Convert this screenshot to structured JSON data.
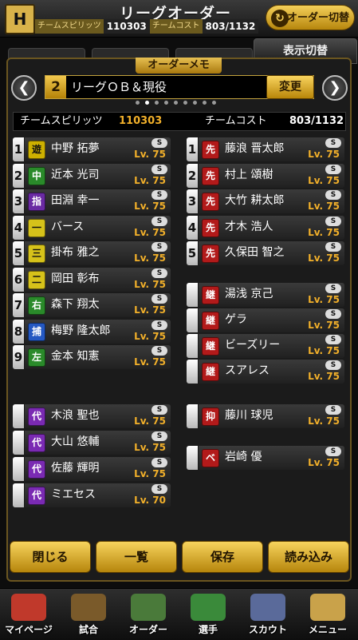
{
  "header": {
    "logo": "H",
    "title": "リーグオーダー",
    "team_spirit_label": "チームスピリッツ",
    "team_spirit_value": "110303",
    "team_cost_label": "チームコスト",
    "team_cost_value": "803/1132",
    "order_switch_label": "オーダー切替",
    "display_switch_label": "表示切替"
  },
  "memo": {
    "title": "オーダーメモ",
    "number": "2",
    "name": "リーグＯＢ＆現役",
    "change_label": "変更",
    "page_count": 9,
    "active_page": 1
  },
  "stats": {
    "spirit_label": "チームスピリッツ",
    "spirit_value": "110303",
    "cost_label": "チームコスト",
    "cost_value": "803/1132"
  },
  "lineup": [
    {
      "num": "1",
      "pos": "遊",
      "name": "中野 拓夢",
      "lv": "Lv. 75"
    },
    {
      "num": "2",
      "pos": "中",
      "name": "近本 光司",
      "lv": "Lv. 75"
    },
    {
      "num": "3",
      "pos": "指",
      "name": "田淵 幸一",
      "lv": "Lv. 75"
    },
    {
      "num": "4",
      "pos": "一",
      "name": "バース",
      "lv": "Lv. 75"
    },
    {
      "num": "5",
      "pos": "三",
      "name": "掛布 雅之",
      "lv": "Lv. 75"
    },
    {
      "num": "6",
      "pos": "二",
      "name": "岡田 彰布",
      "lv": "Lv. 75"
    },
    {
      "num": "7",
      "pos": "右",
      "name": "森下 翔太",
      "lv": "Lv. 75"
    },
    {
      "num": "8",
      "pos": "捕",
      "name": "梅野 隆太郎",
      "lv": "Lv. 75"
    },
    {
      "num": "9",
      "pos": "左",
      "name": "金本 知憲",
      "lv": "Lv. 75"
    }
  ],
  "bench": [
    {
      "pos": "代",
      "name": "木浪 聖也",
      "lv": "Lv. 75"
    },
    {
      "pos": "代",
      "name": "大山 悠輔",
      "lv": "Lv. 75"
    },
    {
      "pos": "代",
      "name": "佐藤 輝明",
      "lv": "Lv. 75"
    },
    {
      "pos": "代",
      "name": "ミエセス",
      "lv": "Lv. 70"
    }
  ],
  "starters": [
    {
      "num": "1",
      "pos": "先",
      "name": "藤浪 晋太郎",
      "lv": "Lv. 75"
    },
    {
      "num": "2",
      "pos": "先",
      "name": "村上 頌樹",
      "lv": "Lv. 75"
    },
    {
      "num": "3",
      "pos": "先",
      "name": "大竹 耕太郎",
      "lv": "Lv. 75"
    },
    {
      "num": "4",
      "pos": "先",
      "name": "才木 浩人",
      "lv": "Lv. 75"
    },
    {
      "num": "5",
      "pos": "先",
      "name": "久保田 智之",
      "lv": "Lv. 75"
    }
  ],
  "relievers": [
    {
      "pos": "継",
      "name": "湯浅 京己",
      "lv": "Lv. 75"
    },
    {
      "pos": "継",
      "name": "ゲラ",
      "lv": "Lv. 75"
    },
    {
      "pos": "継",
      "name": "ビーズリー",
      "lv": "Lv. 75"
    },
    {
      "pos": "継",
      "name": "スアレス",
      "lv": "Lv. 75"
    }
  ],
  "closer": {
    "pos": "抑",
    "name": "藤川 球児",
    "lv": "Lv. 75"
  },
  "reserve": {
    "pos": "ベ",
    "name": "岩崎 優",
    "lv": "Lv. 75"
  },
  "badge_text": "S",
  "buttons": {
    "close": "閉じる",
    "list": "一覧",
    "save": "保存",
    "load": "読み込み"
  },
  "nav": [
    {
      "label": "マイページ",
      "icon": "home-icon",
      "color": "#c0392b"
    },
    {
      "label": "試合",
      "icon": "stadium-icon",
      "color": "#7a5a2a"
    },
    {
      "label": "オーダー",
      "icon": "order-icon",
      "color": "#4a7a3a"
    },
    {
      "label": "選手",
      "icon": "player-icon",
      "color": "#3a8a3a"
    },
    {
      "label": "スカウト",
      "icon": "scout-icon",
      "color": "#5a6a9a"
    },
    {
      "label": "メニュー",
      "icon": "menu-icon",
      "color": "#c9a24a"
    }
  ]
}
